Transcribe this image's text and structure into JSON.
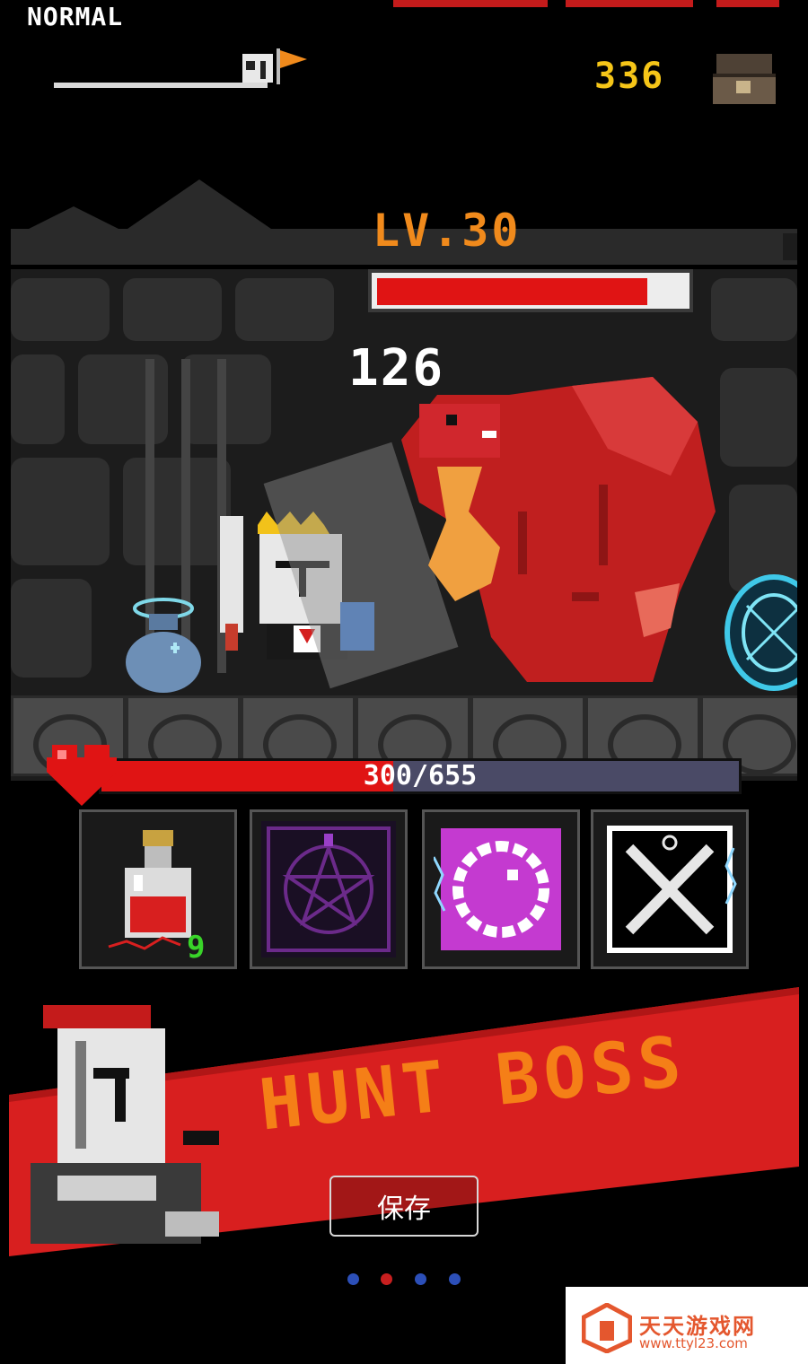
{
  "hud": {
    "difficulty": "NORMAL",
    "stage_progress": 0.95,
    "gold": "336",
    "icons": [
      "skull-flag-icon",
      "treasure-chest-icon"
    ]
  },
  "boss": {
    "level": "LV.30",
    "hp_fraction": 0.88,
    "damage": "126"
  },
  "player": {
    "hp_text": "300/655",
    "hp_fraction": 0.458,
    "icons": [
      "heart-icon"
    ]
  },
  "skills": [
    {
      "name": "potion",
      "icon": "health-potion-icon",
      "count": "9"
    },
    {
      "name": "dark-seal",
      "icon": "pentagram-rune-icon"
    },
    {
      "name": "shield-orb",
      "icon": "magic-orb-icon"
    },
    {
      "name": "crossed-swords",
      "icon": "crossed-swords-icon"
    }
  ],
  "banner": {
    "headline": "HUNT BOSS",
    "save_label": "保存",
    "page_count": 4,
    "active_page": 1
  },
  "watermark": {
    "name": "天天游戏网",
    "url": "www.ttyl23.com"
  },
  "colors": {
    "gold": "#f5c518",
    "level": "#f08a1c",
    "hp_red": "#e01414",
    "potion_count": "#39d429",
    "banner_red": "#d81f1f",
    "headline": "#f57f17",
    "dot_inactive": "#2c4fb8",
    "dot_active": "#c81f1f"
  }
}
